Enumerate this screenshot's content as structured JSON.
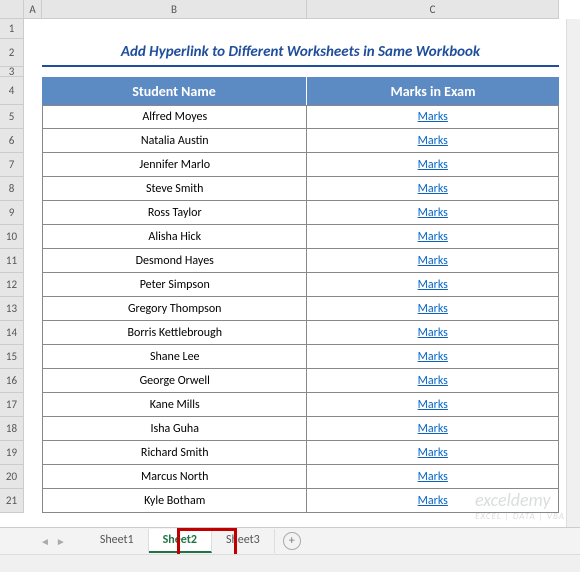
{
  "columns": [
    "A",
    "B",
    "C"
  ],
  "row_count": 21,
  "title": "Add Hyperlink to Different Worksheets in Same Workbook",
  "table_header": {
    "b": "Student Name",
    "c": "Marks in Exam"
  },
  "link_label": "Marks",
  "students": [
    "Alfred Moyes",
    "Natalia Austin",
    "Jennifer Marlo",
    "Steve Smith",
    "Ross Taylor",
    "Alisha Hick",
    "Desmond Hayes",
    "Peter Simpson",
    "Gregory Thompson",
    "Borris Kettlebrough",
    "Shane Lee",
    "George Orwell",
    "Kane Mills",
    "Isha Guha",
    "Richard Smith",
    "Marcus North",
    "Kyle Botham"
  ],
  "tabs": [
    {
      "label": "Sheet1",
      "active": false
    },
    {
      "label": "Sheet2",
      "active": true
    },
    {
      "label": "Sheet3",
      "active": false
    }
  ],
  "watermark": {
    "main": "exceldemy",
    "sub": "EXCEL | DATA | VBA"
  }
}
